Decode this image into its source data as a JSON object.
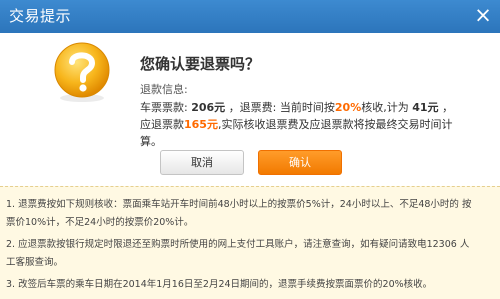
{
  "dialog": {
    "title": "交易提示",
    "close_glyph": "×"
  },
  "icon": "question-mark-warning-icon",
  "colors": {
    "titlebar": "#2c75bb",
    "accent_orange": "#ff6a00",
    "notice_bg": "#fff9e3"
  },
  "prompt": {
    "heading": "您确认要退票吗？",
    "refund_info_title": "退款信息:",
    "detail": {
      "ticket_label": "车票票款:",
      "ticket_amount": "206元",
      "fee_label": "，退票费:",
      "fee_text_1": "当前时间按",
      "fee_rate": "20%",
      "fee_text_2": "核收,计为",
      "fee_amount": "41元",
      "refund_label": "，应退票款",
      "refund_amount": "165元",
      "tail": ",实际核收退票费及应退票款将按最终交易时间计算。"
    }
  },
  "buttons": {
    "cancel": "取消",
    "confirm": "确认"
  },
  "notes": {
    "line1": "1. 退票费按如下规则核收：票面乘车站开车时间前48小时以上的按票价5%计，24小时以上、不足48小时的 按",
    "line2": "票价10%计，不足24小时的按票价20%计。",
    "line3": "2. 应退票款按银行规定时限退还至购票时所使用的网上支付工具账户，请注意查询，如有疑问请致电12306 人",
    "line4": "工客服查询。",
    "line5": "3. 改签后车票的乘车日期在2014年1月16日至2月24日期间的，退票手续费按票面票价的20%核收。"
  }
}
